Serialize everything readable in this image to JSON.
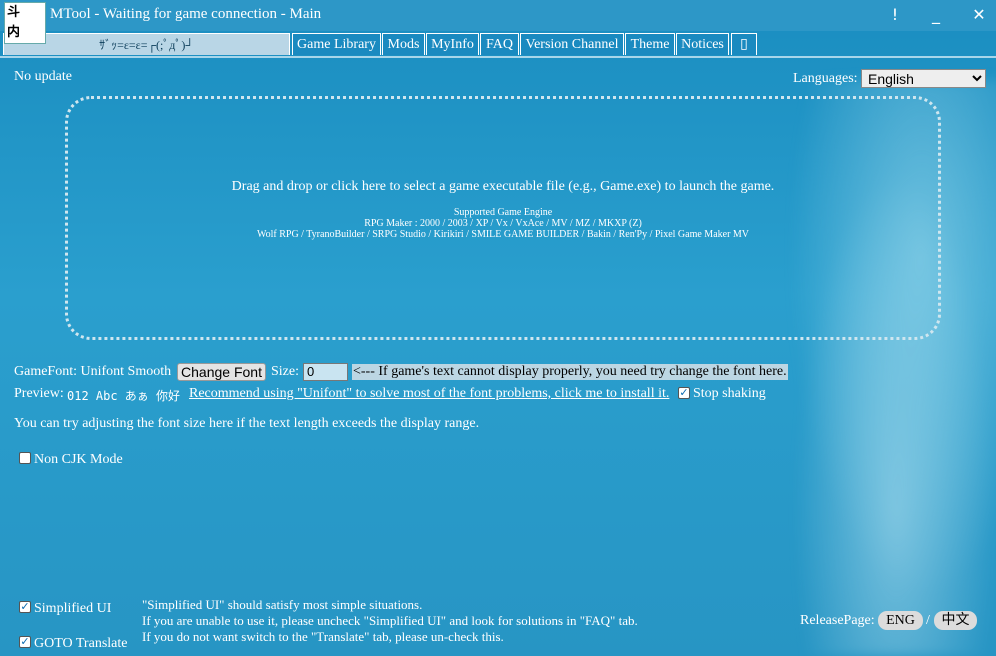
{
  "window": {
    "title": "MTool - Waiting for game connection - Main",
    "icon_text": "斗\n内"
  },
  "controls": {
    "alert": "!",
    "minimize": "_",
    "close": "✕"
  },
  "tabs": [
    {
      "label": "ｻﾞｯ=ε=ε=┌(;ﾟдﾟ)┘",
      "active": true
    },
    {
      "label": "Game Library"
    },
    {
      "label": "Mods"
    },
    {
      "label": "MyInfo"
    },
    {
      "label": "FAQ"
    },
    {
      "label": "Version Channel"
    },
    {
      "label": "Theme"
    },
    {
      "label": "Notices"
    },
    {
      "label": "▯"
    }
  ],
  "status": "No update",
  "language": {
    "label": "Languages:",
    "selected": "English"
  },
  "dropzone": {
    "main": "Drag and drop or click here to select a game executable file (e.g., Game.exe) to launch the game.",
    "engines_title": "Supported Game Engine",
    "engines_line1": "RPG Maker : 2000 / 2003 / XP / Vx / VxAce / MV / MZ / MKXP (Z)",
    "engines_line2": "Wolf RPG / TyranoBuilder / SRPG Studio / Kirikiri / SMILE GAME BUILDER / Bakin / Ren'Py / Pixel Game Maker MV"
  },
  "font": {
    "label": "GameFont: Unifont Smooth",
    "change_button": "Change Font",
    "size_label": "Size:",
    "size_value": "0",
    "hint": "<--- If game's text cannot display properly, you need try change the font here."
  },
  "preview": {
    "label": "Preview:",
    "sample": "012 Abc あぁ 你好",
    "link": "Recommend using \"Unifont\" to solve most of the font problems, click me to install it.",
    "stop_shaking": "Stop shaking"
  },
  "adjust_hint": "You can try adjusting the font size here if the text length exceeds the display range.",
  "non_cjk": "Non CJK Mode",
  "simplified_ui": "Simplified UI",
  "goto_translate": "GOTO Translate",
  "notes": [
    "\"Simplified UI\" should satisfy most simple situations.",
    "If you are unable to use it, please uncheck \"Simplified UI\" and look for solutions in \"FAQ\" tab.",
    "If you do not want switch to the \"Translate\" tab, please un-check this."
  ],
  "release": {
    "label": "ReleasePage:",
    "eng": "ENG",
    "sep": "/",
    "zh": "中文"
  }
}
